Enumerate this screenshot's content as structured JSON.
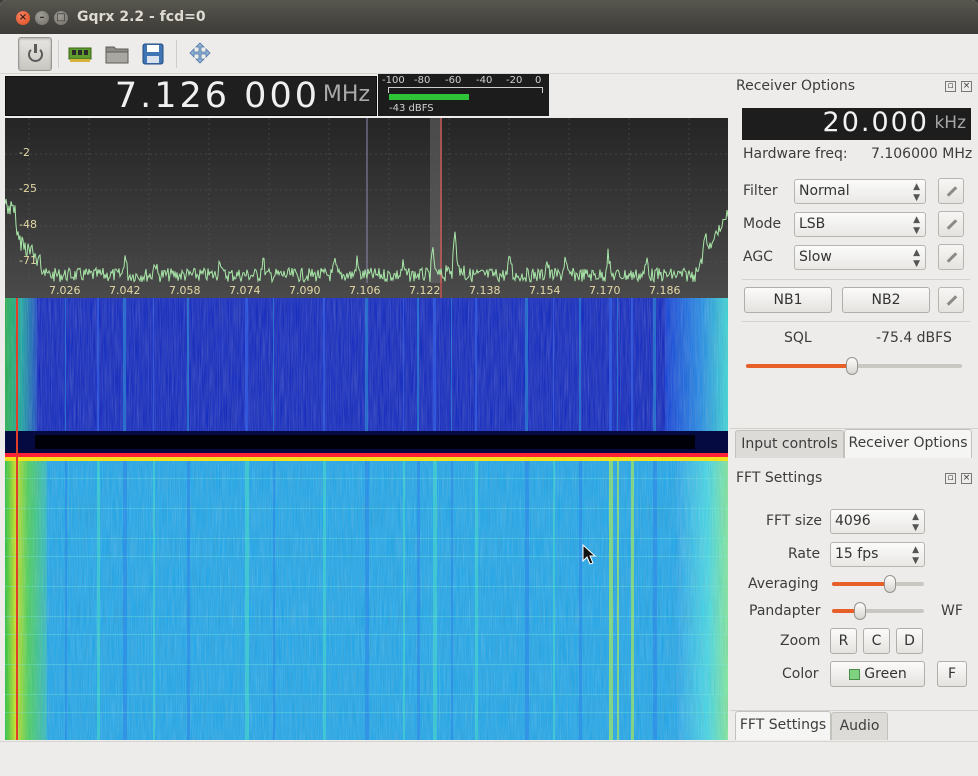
{
  "window": {
    "title": "Gqrx 2.2 - fcd=0",
    "close": "×",
    "minimize": "–",
    "maximize": "□"
  },
  "toolbar": {
    "icons": [
      "power-icon",
      "device-icon",
      "open-folder-icon",
      "save-icon",
      "fullscreen-icon"
    ]
  },
  "frequency": {
    "value": "7.126 000",
    "unit": "MHz"
  },
  "meter": {
    "scale": [
      "-100",
      "-80",
      "-60",
      "-40",
      "-20",
      "0"
    ],
    "level_text": "-43 dBFS",
    "level_value": -43
  },
  "spectrum": {
    "y_labels": [
      "-2",
      "-25",
      "-48",
      "-71"
    ],
    "x_labels": [
      "7.026",
      "7.042",
      "7.058",
      "7.074",
      "7.090",
      "7.106",
      "7.122",
      "7.138",
      "7.154",
      "7.170",
      "7.186"
    ],
    "trace_color": "#a8e6a8",
    "marker_color": "#ff5a5a"
  },
  "receiver_options": {
    "title": "Receiver Options",
    "offset": {
      "value": "20.000",
      "unit": "kHz"
    },
    "hw_freq_label": "Hardware freq:",
    "hw_freq_value": "7.106000 MHz",
    "filter_label": "Filter",
    "filter_value": "Normal",
    "mode_label": "Mode",
    "mode_value": "LSB",
    "agc_label": "AGC",
    "agc_value": "Slow",
    "nb1": "NB1",
    "nb2": "NB2",
    "sql_label": "SQL",
    "sql_value": "-75.4 dBFS",
    "sql_fraction": 0.49
  },
  "upper_tabs": [
    "Input controls",
    "Receiver Options"
  ],
  "fft_settings": {
    "title": "FFT Settings",
    "fft_size_label": "FFT size",
    "fft_size_value": "4096",
    "rate_label": "Rate",
    "rate_value": "15 fps",
    "averaging_label": "Averaging",
    "averaging_fraction": 0.63,
    "pandapter_label": "Pandapter",
    "pandapter_fraction": 0.3,
    "wf_label": "WF",
    "zoom_label": "Zoom",
    "zoom_r": "R",
    "zoom_c": "C",
    "zoom_d": "D",
    "color_label": "Color",
    "color_value": "Green",
    "f_button": "F"
  },
  "lower_tabs": [
    "FFT Settings",
    "Audio"
  ]
}
